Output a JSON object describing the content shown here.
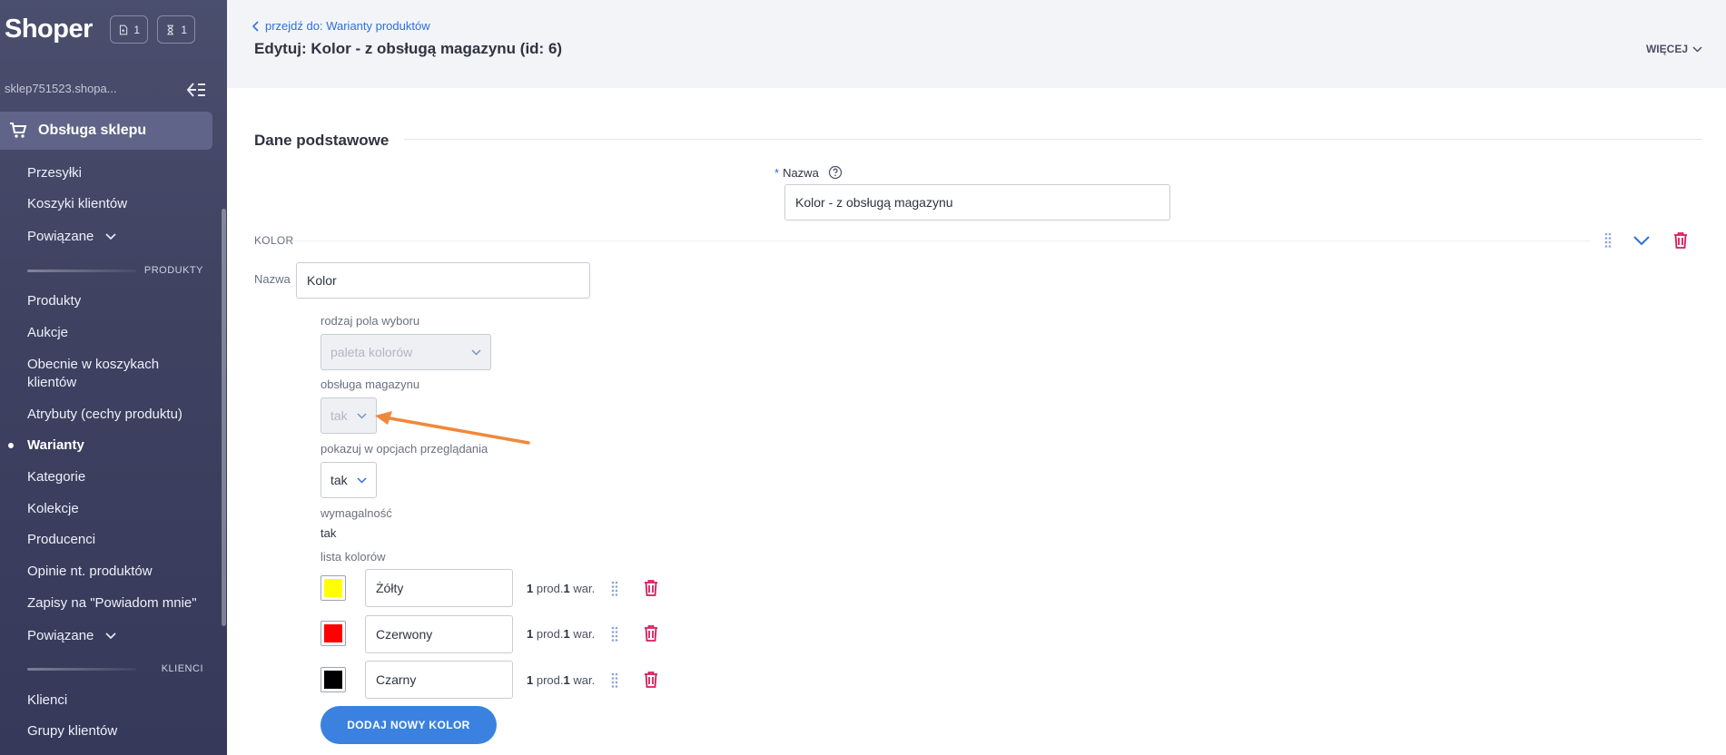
{
  "app": {
    "name": "Shoper"
  },
  "sidebar": {
    "badge_pages": "1",
    "badge_pending": "1",
    "shop_url": "sklep751523.shopa...",
    "active_section": "Obsługa sklepu",
    "items_top": [
      "Przesyłki",
      "Koszyki klientów",
      "Powiązane"
    ],
    "section_produkty": "PRODUKTY",
    "items_produkty": [
      "Produkty",
      "Aukcje",
      "Obecnie w koszykach klientów",
      "Atrybuty (cechy produktu)",
      "Warianty",
      "Kategorie",
      "Kolekcje",
      "Producenci",
      "Opinie nt. produktów",
      "Zapisy na \"Powiadom mnie\"",
      "Powiązane"
    ],
    "section_klienci": "KLIENCI",
    "items_klienci": [
      "Klienci",
      "Grupy klientów"
    ]
  },
  "header": {
    "back_link": "przejdź do: Warianty produktów",
    "title": "Edytuj: Kolor - z obsługą magazynu (id: 6)",
    "more": "WIĘCEJ"
  },
  "form": {
    "section_title": "Dane podstawowe",
    "required_mark": "*",
    "name_label": "Nazwa",
    "name_value": "Kolor - z obsługą magazynu",
    "group_label": "KOLOR",
    "group_name_label": "Nazwa",
    "group_name_value": "Kolor",
    "select_type_label": "rodzaj pola wyboru",
    "select_type_value": "paleta kolorów",
    "stock_label": "obsługa magazynu",
    "stock_value": "tak",
    "show_label": "pokazuj w opcjach przeglądania",
    "show_value": "tak",
    "required_label": "wymagalność",
    "required_value": "tak",
    "colors_label": "lista kolorów",
    "colors": [
      {
        "name": "Żółty",
        "swatch": "#ffff00",
        "prod": "1",
        "prod_label": "prod.",
        "war": "1",
        "war_label": "war."
      },
      {
        "name": "Czerwony",
        "swatch": "#ff0000",
        "prod": "1",
        "prod_label": "prod.",
        "war": "1",
        "war_label": "war."
      },
      {
        "name": "Czarny",
        "swatch": "#000000",
        "prod": "1",
        "prod_label": "prod.",
        "war": "1",
        "war_label": "war."
      }
    ],
    "add_color_button": "DODAJ NOWY KOLOR"
  },
  "colors": {
    "accent": "#3b82e0",
    "danger": "#d81b5a",
    "annotation_arrow": "#f0883a"
  }
}
